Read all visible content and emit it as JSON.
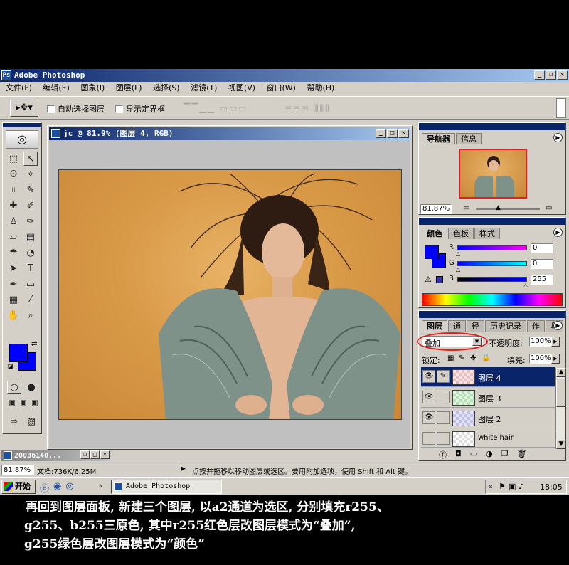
{
  "app": {
    "title": "Adobe Photoshop"
  },
  "menu": [
    "文件(F)",
    "编辑(E)",
    "图象(I)",
    "图层(L)",
    "选择(S)",
    "滤镜(T)",
    "视图(V)",
    "窗口(W)",
    "帮助(H)"
  ],
  "options": {
    "auto_select": "自动选择图层",
    "show_bounds": "显示定界框"
  },
  "document": {
    "title": "jc @ 81.9% (图层 4, RGB)"
  },
  "navigator": {
    "tabs": [
      "导航器",
      "信息"
    ],
    "zoom": "81.87%"
  },
  "color_panel": {
    "tabs": [
      "颜色",
      "色板",
      "样式"
    ],
    "r_label": "R",
    "g_label": "G",
    "b_label": "B",
    "r": "0",
    "g": "0",
    "b": "255",
    "fg_color": "#0000ff"
  },
  "layers_panel": {
    "tabs": [
      "图层",
      "通",
      "径",
      "历史记录",
      "作",
      "具"
    ],
    "blend_mode": "叠加",
    "opacity_label": "不透明度:",
    "opacity": "100%",
    "lock_label": "锁定:",
    "fill_label": "填充:",
    "fill": "100%",
    "layers": [
      {
        "name": "图层 4",
        "selected": true,
        "visible": true
      },
      {
        "name": "图层 3",
        "selected": false,
        "visible": true
      },
      {
        "name": "图层 2",
        "selected": false,
        "visible": true
      },
      {
        "name": "white hair",
        "selected": false,
        "visible": false
      }
    ]
  },
  "minimized_doc": {
    "title": "20036140..."
  },
  "status": {
    "zoom": "81.87%",
    "doc_size": "文档:736K/6.25M",
    "hint": "点按并拖移以移动图层或选区。要用附加选项，使用 Shift 和 Alt 键。"
  },
  "taskbar": {
    "start": "开始",
    "task": "Adobe Photoshop",
    "clock": "18:05"
  },
  "caption": {
    "line1": "再回到图层面板, 新建三个图层, 以a2通道为选区, 分别填充r255、",
    "line2": "g255、b255三原色, 其中r255红色层改图层模式为“叠加”,",
    "line3": "g255绿色层改图层模式为“颜色”"
  }
}
